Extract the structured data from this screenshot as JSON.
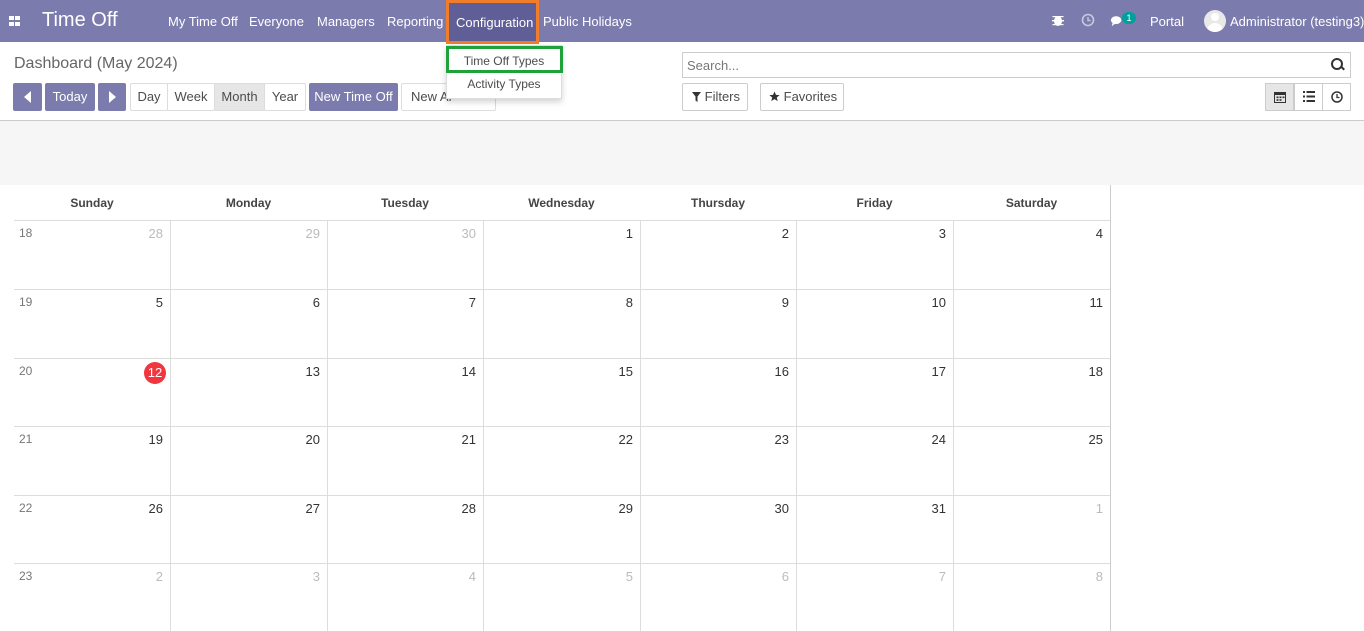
{
  "navbar": {
    "app_title": "Time Off",
    "menu": [
      "My Time Off",
      "Everyone",
      "Managers",
      "Reporting",
      "Configuration",
      "Public Holidays"
    ],
    "messages_count": "1",
    "portal": "Portal",
    "user": "Administrator (testing3)"
  },
  "configuration_menu": {
    "items": [
      "Time Off Types",
      "Activity Types"
    ]
  },
  "page": {
    "title": "Dashboard (May 2024)"
  },
  "toolbar": {
    "today": "Today",
    "scales": [
      "Day",
      "Week",
      "Month",
      "Year"
    ],
    "active_scale": "Month",
    "new_time_off": "New Time Off",
    "new_allocation": "New Al"
  },
  "search": {
    "placeholder": "Search...",
    "filters": "Filters",
    "favorites": "Favorites"
  },
  "views": [
    "calendar-icon",
    "list-icon",
    "activity-icon"
  ],
  "calendar": {
    "days_of_week": [
      "Sunday",
      "Monday",
      "Tuesday",
      "Wednesday",
      "Thursday",
      "Friday",
      "Saturday"
    ],
    "today": "12",
    "weeks": [
      {
        "week": "18",
        "days": [
          "28",
          "29",
          "30",
          "1",
          "2",
          "3",
          "4"
        ]
      },
      {
        "week": "19",
        "days": [
          "5",
          "6",
          "7",
          "8",
          "9",
          "10",
          "11"
        ]
      },
      {
        "week": "20",
        "days": [
          "12",
          "13",
          "14",
          "15",
          "16",
          "17",
          "18"
        ]
      },
      {
        "week": "21",
        "days": [
          "19",
          "20",
          "21",
          "22",
          "23",
          "24",
          "25"
        ]
      },
      {
        "week": "22",
        "days": [
          "26",
          "27",
          "28",
          "29",
          "30",
          "31",
          "1"
        ]
      },
      {
        "week": "23",
        "days": [
          "2",
          "3",
          "4",
          "5",
          "6",
          "7",
          "8"
        ]
      }
    ]
  },
  "colors": {
    "navbar": "#7c7bad",
    "highlight_orange": "#f07d2a",
    "highlight_green": "#1fa23a",
    "today_badge": "#f0363f"
  }
}
